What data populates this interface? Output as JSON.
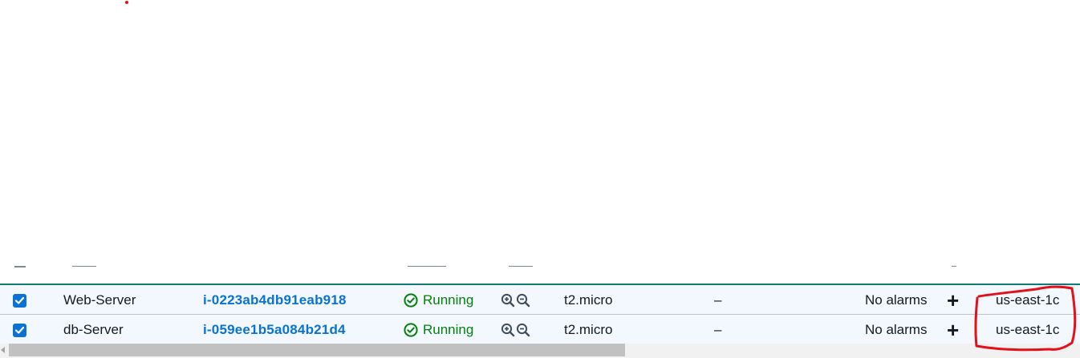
{
  "table": {
    "rows": [
      {
        "selected": true,
        "name": "Web-Server",
        "instance_id": "i-0223ab4db91eab918",
        "state": "Running",
        "state_icon": "check-circle-icon",
        "type": "t2.micro",
        "status_check": "–",
        "alarm_status": "No alarms",
        "add_alarm": "+",
        "availability_zone": "us-east-1c"
      },
      {
        "selected": true,
        "name": "db-Server",
        "instance_id": "i-059ee1b5a084b21d4",
        "state": "Running",
        "state_icon": "check-circle-icon",
        "type": "t2.micro",
        "status_check": "–",
        "alarm_status": "No alarms",
        "add_alarm": "+",
        "availability_zone": "us-east-1c"
      }
    ]
  },
  "colors": {
    "link": "#0972d3",
    "running": "#037f0c",
    "selected_row_bg": "#f2f8fd",
    "annotation": "#e3101a"
  }
}
